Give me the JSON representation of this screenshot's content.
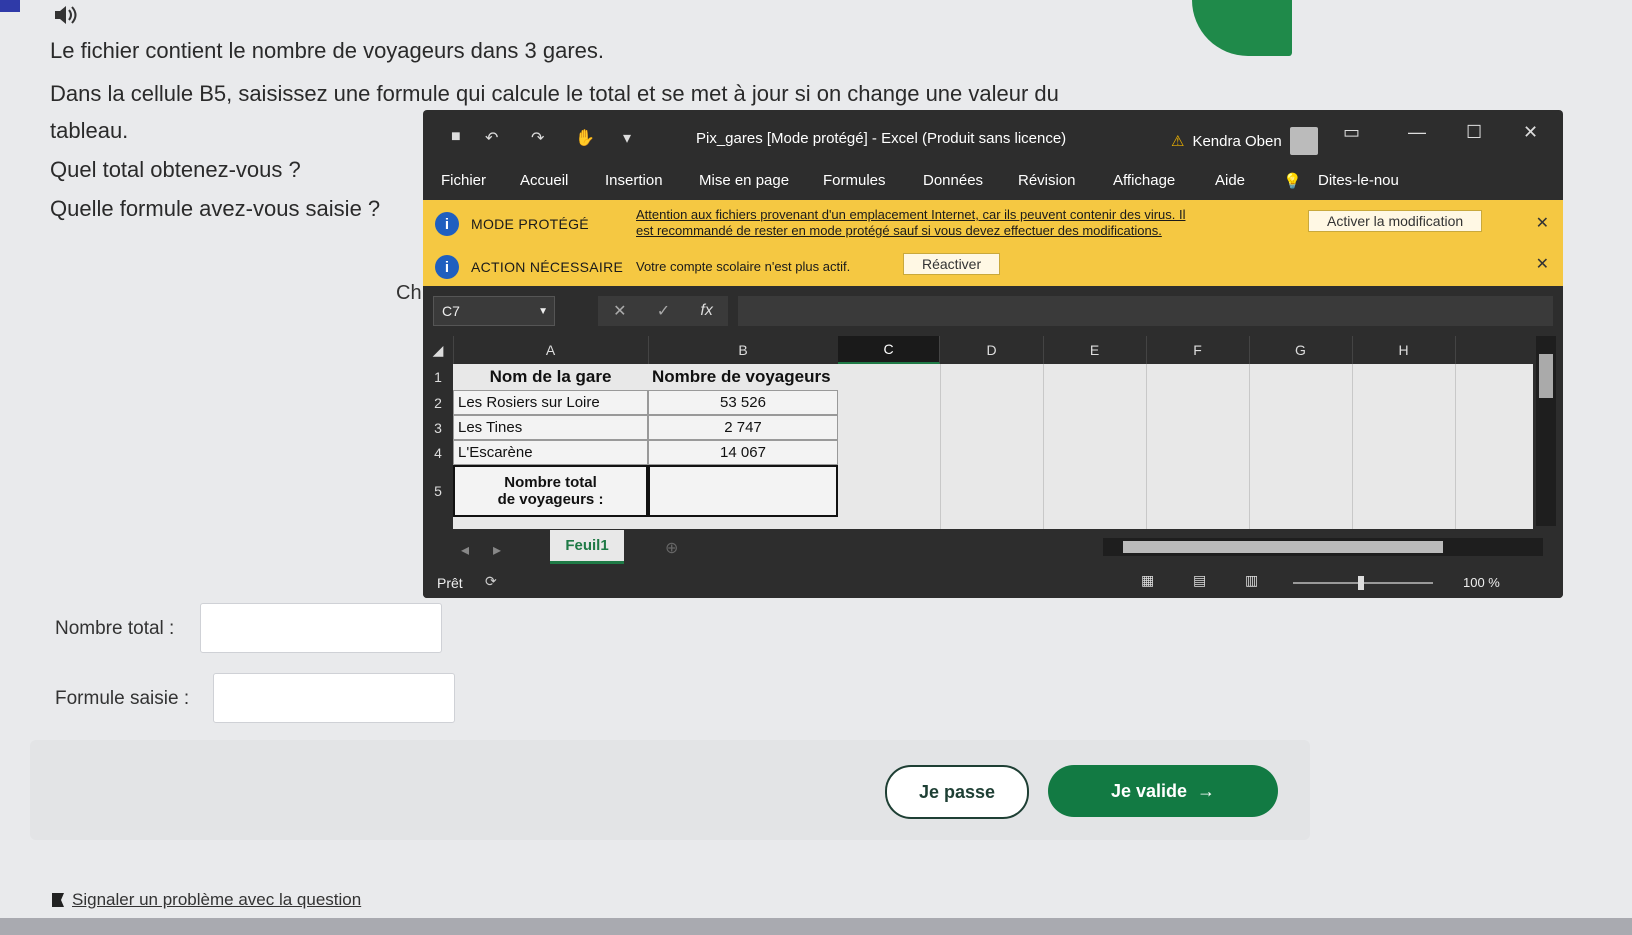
{
  "question": {
    "line1": "Le fichier contient le nombre de voyageurs dans 3 gares.",
    "line2": "Dans la cellule B5, saisissez une formule qui calcule le total et se met à jour si on change une valeur du",
    "line3": "tableau.",
    "line4": "Quel total obtenez-vous ?",
    "line5": "Quelle formule avez-vous saisie ?",
    "partial": "Ch"
  },
  "form": {
    "total_label": "Nombre total :",
    "total_value": "",
    "formula_label": "Formule saisie :",
    "formula_value": ""
  },
  "buttons": {
    "skip": "Je passe",
    "validate": "Je valide",
    "validate_arrow": "→"
  },
  "report_link": "Signaler un problème avec la question",
  "excel": {
    "title": "Pix_gares  [Mode protégé]  -  Excel (Produit sans licence)",
    "user": "Kendra Oben",
    "warning_symbol": "⚠",
    "menu": [
      "Fichier",
      "Accueil",
      "Insertion",
      "Mise en page",
      "Formules",
      "Données",
      "Révision",
      "Affichage",
      "Aide",
      "Dites-le-nou"
    ],
    "protected_bar": {
      "name": "MODE PROTÉGÉ",
      "message_1": "Attention aux fichiers provenant d'un emplacement Internet, car ils peuvent contenir des virus. Il",
      "message_2": "est recommandé de rester en mode protégé sauf si vous devez effectuer des modifications.",
      "button": "Activer la modification"
    },
    "action_bar": {
      "name": "ACTION NÉCESSAIRE",
      "message": "Votre compte scolaire n'est plus actif.",
      "button": "Réactiver"
    },
    "name_box": "C7",
    "formula": "",
    "fx": "fx",
    "columns": [
      "A",
      "B",
      "C",
      "D",
      "E",
      "F",
      "G",
      "H"
    ],
    "rows": [
      "1",
      "2",
      "3",
      "4",
      "5"
    ],
    "table": {
      "header_a": "Nom de la gare",
      "header_b": "Nombre de voyageurs",
      "stations": [
        "Les Rosiers sur Loire",
        "Les Tines",
        "L'Escarène"
      ],
      "values": [
        "53 526",
        "2 747",
        "14 067"
      ],
      "total_label_1": "Nombre total",
      "total_label_2": "de voyageurs :",
      "total_value": ""
    },
    "sheet_tab": "Feuil1",
    "status": "Prêt",
    "zoom": "100 %"
  }
}
